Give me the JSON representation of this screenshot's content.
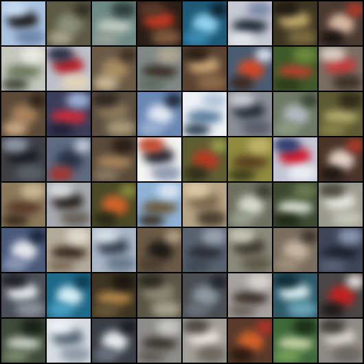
{
  "grid": {
    "rows": 8,
    "cols": 8,
    "tiles": [
      {
        "bg": "#a9c3e2",
        "blobs": [
          "#1e1e1e",
          "#c9dcef",
          "#6f86a8"
        ]
      },
      {
        "bg": "#5c5a45",
        "blobs": [
          "#8a8f79",
          "#2d2c22",
          "#a9a48c"
        ]
      },
      {
        "bg": "#6e8a84",
        "blobs": [
          "#c4cdc6",
          "#2e3d3a",
          "#9ba39a"
        ]
      },
      {
        "bg": "#2a1e18",
        "blobs": [
          "#c13a22",
          "#5a3a2a",
          "#7e5a3e"
        ]
      },
      {
        "bg": "#1e5a78",
        "blobs": [
          "#8fd2f0",
          "#0e1e28",
          "#3d8db5"
        ]
      },
      {
        "bg": "#c6c9d3",
        "blobs": [
          "#1f2836",
          "#7c8aa8",
          "#e6e8ee"
        ]
      },
      {
        "bg": "#3e3520",
        "blobs": [
          "#c0a86c",
          "#1e1a10",
          "#7a6b40"
        ]
      },
      {
        "bg": "#4a3a30",
        "blobs": [
          "#d9b9a3",
          "#b23a2a",
          "#1a1410"
        ]
      },
      {
        "bg": "#c4c7bd",
        "blobs": [
          "#6c7a5c",
          "#e8ebe3",
          "#3e4536"
        ]
      },
      {
        "bg": "#bcc0c9",
        "blobs": [
          "#b3222a",
          "#2b2f44",
          "#e2d4b8"
        ]
      },
      {
        "bg": "#6a5a46",
        "blobs": [
          "#a88e62",
          "#3a2e22",
          "#c9b895"
        ]
      },
      {
        "bg": "#7f8886",
        "blobs": [
          "#3a3028",
          "#b1a690",
          "#5e6a5f"
        ]
      },
      {
        "bg": "#5a4332",
        "blobs": [
          "#c8a476",
          "#2a1e16",
          "#8e6a4a"
        ]
      },
      {
        "bg": "#4a5c72",
        "blobs": [
          "#d24a26",
          "#e0e6f0",
          "#3a2a22"
        ]
      },
      {
        "bg": "#3e5a2a",
        "blobs": [
          "#b2432e",
          "#6e8a3c",
          "#2a3a1a"
        ]
      },
      {
        "bg": "#7a6e62",
        "blobs": [
          "#c23a3a",
          "#d9cfc2",
          "#3e3228"
        ]
      },
      {
        "bg": "#5c4a38",
        "blobs": [
          "#a8825a",
          "#2a2018",
          "#c9a882"
        ]
      },
      {
        "bg": "#3a3e5a",
        "blobs": [
          "#d22a3a",
          "#9eb0d8",
          "#1e2036"
        ]
      },
      {
        "bg": "#5a4e3e",
        "blobs": [
          "#8e7a5c",
          "#2e2620",
          "#a89878"
        ]
      },
      {
        "bg": "#6a88b5",
        "blobs": [
          "#e0e8f2",
          "#1a2230",
          "#9ab0cf"
        ]
      },
      {
        "bg": "#eef2f6",
        "blobs": [
          "#5a7ea0",
          "#b2c6da",
          "#2a3e50"
        ]
      },
      {
        "bg": "#8a8e96",
        "blobs": [
          "#2a2e3a",
          "#c6c8ce",
          "#5a5e6a"
        ]
      },
      {
        "bg": "#6e7a66",
        "blobs": [
          "#b2bac2",
          "#3a4232",
          "#8e9a82"
        ]
      },
      {
        "bg": "#5e5a32",
        "blobs": [
          "#b2aa6e",
          "#2e2a16",
          "#8a844a"
        ]
      },
      {
        "bg": "#3e4046",
        "blobs": [
          "#1a1c20",
          "#8e98a6",
          "#5a5e66"
        ]
      },
      {
        "bg": "#5e6a80",
        "blobs": [
          "#2a3448",
          "#c4ccd8",
          "#a2362e"
        ]
      },
      {
        "bg": "#5a4a3a",
        "blobs": [
          "#a8865e",
          "#2a1e16",
          "#8a7a66"
        ]
      },
      {
        "bg": "#f4f4f2",
        "blobs": [
          "#2a2e3a",
          "#c2462a",
          "#8e9ab0"
        ]
      },
      {
        "bg": "#5e5e34",
        "blobs": [
          "#b23a22",
          "#9aa04e",
          "#2e2e1a"
        ]
      },
      {
        "bg": "#8e8a3e",
        "blobs": [
          "#5a3e22",
          "#c0b46a",
          "#3a3a1a"
        ]
      },
      {
        "bg": "#c2c6d4",
        "blobs": [
          "#d21a2e",
          "#2a3a6a",
          "#eceef4"
        ]
      },
      {
        "bg": "#4a3428",
        "blobs": [
          "#e2d2c6",
          "#b23a2a",
          "#1e1612"
        ]
      },
      {
        "bg": "#8a7a5a",
        "blobs": [
          "#5a3a2a",
          "#c6b896",
          "#3a2a1e"
        ]
      },
      {
        "bg": "#a6aaae",
        "blobs": [
          "#2a2420",
          "#d6d8da",
          "#6a625a"
        ]
      },
      {
        "bg": "#4a4a26",
        "blobs": [
          "#d2642a",
          "#8a8a3e",
          "#2a2a16"
        ]
      },
      {
        "bg": "#8eb2d8",
        "blobs": [
          "#6a5a3a",
          "#d8e4f0",
          "#3a3226"
        ]
      },
      {
        "bg": "#b6a486",
        "blobs": [
          "#7a6a4e",
          "#dccaa6",
          "#4a3e2e"
        ]
      },
      {
        "bg": "#6e7060",
        "blobs": [
          "#d6d8ce",
          "#3a3c30",
          "#9aa08e"
        ]
      },
      {
        "bg": "#3e4a30",
        "blobs": [
          "#d6dcd0",
          "#6a7a52",
          "#1e2616"
        ]
      },
      {
        "bg": "#9a9a8e",
        "blobs": [
          "#e6e8e2",
          "#4a4a3e",
          "#c2c4b6"
        ]
      },
      {
        "bg": "#4a5a7a",
        "blobs": [
          "#e6e8ee",
          "#1a2236",
          "#8a98b4"
        ]
      },
      {
        "bg": "#b2aa9a",
        "blobs": [
          "#3a2a20",
          "#e0dace",
          "#7a6a56"
        ]
      },
      {
        "bg": "#a8b6c6",
        "blobs": [
          "#3a4252",
          "#d6dee6",
          "#6a7a8e"
        ]
      },
      {
        "bg": "#6a5a46",
        "blobs": [
          "#1e1a16",
          "#b2a286",
          "#4a3e30"
        ]
      },
      {
        "bg": "#5a6270",
        "blobs": [
          "#2a2e36",
          "#9aa2ae",
          "#3e4652"
        ]
      },
      {
        "bg": "#8a8a7a",
        "blobs": [
          "#3e3a32",
          "#c6c6b6",
          "#5e5a4a"
        ]
      },
      {
        "bg": "#7a6e5e",
        "blobs": [
          "#c6b6a2",
          "#3a3228",
          "#9e8e7a"
        ]
      },
      {
        "bg": "#3e4658",
        "blobs": [
          "#1e2230",
          "#8a96b0",
          "#5a6478"
        ]
      },
      {
        "bg": "#4a4e58",
        "blobs": [
          "#e6e8ec",
          "#1e2026",
          "#8a8e98"
        ]
      },
      {
        "bg": "#1e6a8a",
        "blobs": [
          "#d6eef6",
          "#0e3a4e",
          "#4aa2c6"
        ]
      },
      {
        "bg": "#3e3422",
        "blobs": [
          "#b2864a",
          "#1a1610",
          "#6a5a3a"
        ]
      },
      {
        "bg": "#5a5646",
        "blobs": [
          "#8e8a76",
          "#2a2820",
          "#a6a28e"
        ]
      },
      {
        "bg": "#4a4e52",
        "blobs": [
          "#8e9aa2",
          "#1e2226",
          "#6a727a"
        ]
      },
      {
        "bg": "#a6a2a0",
        "blobs": [
          "#3a302a",
          "#d6d2ce",
          "#6a625c"
        ]
      },
      {
        "bg": "#2e5a6a",
        "blobs": [
          "#d6eaee",
          "#0e2a36",
          "#6aa6b6"
        ]
      },
      {
        "bg": "#4a4646",
        "blobs": [
          "#c2221e",
          "#e6e2de",
          "#1e1a1a"
        ]
      },
      {
        "bg": "#3e4a3a",
        "blobs": [
          "#c6ccc2",
          "#1a2016",
          "#7a8a6e"
        ]
      },
      {
        "bg": "#d6dce2",
        "blobs": [
          "#5a6a7a",
          "#eef2f6",
          "#8e9aa6"
        ]
      },
      {
        "bg": "#3a3e46",
        "blobs": [
          "#e6eaee",
          "#1a1c22",
          "#6a727e"
        ]
      },
      {
        "bg": "#8e8e8a",
        "blobs": [
          "#3a3632",
          "#c6c6c2",
          "#5e5a56"
        ]
      },
      {
        "bg": "#a29e96",
        "blobs": [
          "#e6e2dc",
          "#4a4640",
          "#6a665e"
        ]
      },
      {
        "bg": "#5a3a2a",
        "blobs": [
          "#d2622a",
          "#b2322a",
          "#2a1a12"
        ]
      },
      {
        "bg": "#3e6a3a",
        "blobs": [
          "#c6d2a6",
          "#1a2e16",
          "#7aa25a"
        ]
      },
      {
        "bg": "#8e8a86",
        "blobs": [
          "#d6d2ce",
          "#3e3a36",
          "#6a6662"
        ]
      }
    ]
  }
}
